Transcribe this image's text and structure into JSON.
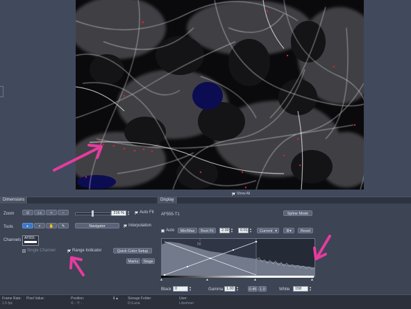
{
  "viewer": {
    "show_all_label": "Show All"
  },
  "dimensions": {
    "tab_label": "Dimensions",
    "zoom_label": "Zoom",
    "zoom_value": "216 %",
    "auto_fit_label": "Auto Fit",
    "auto_fit_checked": true,
    "tools_label": "Tools",
    "navigator_label": "Navigator",
    "interpolation_label": "Interpolation",
    "interpolation_checked": true,
    "channels_label": "Channels",
    "channel_name": "AF555",
    "single_channel_label": "Single Channel",
    "range_indicator_label": "Range Indicator",
    "range_indicator_checked": true,
    "quick_color_setup_label": "Quick Color Setup",
    "marks_label": "Marks",
    "stage_label": "Stage",
    "zoom_icons": [
      "fit-view-icon",
      "zoom-100-icon",
      "zoom-in-icon",
      "zoom-out-icon"
    ],
    "tool_icons": [
      "pointer-icon",
      "magnifier-tool-icon",
      "hand-pan-icon",
      "eyedropper-icon"
    ]
  },
  "display": {
    "tab_label": "Display",
    "channel_title": "AF555-T1",
    "spline_mode_label": "Spline Mode",
    "auto_label": "Auto",
    "min_max_label": "Min/Max",
    "best_fit_label": "Best Fit",
    "best_fit_value": "2.00",
    "step_value": "0.01",
    "current_label": "Current",
    "reset_label": "Reset",
    "histogram_tick": "50",
    "black_label": "Black",
    "black_value": "0",
    "gamma_label": "Gamma",
    "gamma_value": "1.00",
    "gamma_preset_1": "0.45",
    "gamma_preset_2": "1.0",
    "white_label": "White",
    "white_value": "158"
  },
  "status_bar": {
    "frame_rate_label": "Frame Rate:",
    "frame_rate_value": "1.5 fps",
    "pixel_value_label": "Pixel Value:",
    "position_label": "Position:",
    "position_value": "X: -   Y: -",
    "storage_folder_label": "Storage Folder:",
    "storage_folder_value": "D:\\Lana",
    "user_label": "User:",
    "user_value": "Ldoehner"
  },
  "colors": {
    "annotation_arrow": "#e63b9e",
    "background": "#3b4252",
    "accent_blue": "#3c78c8",
    "saturation_red": "#d8222a"
  }
}
